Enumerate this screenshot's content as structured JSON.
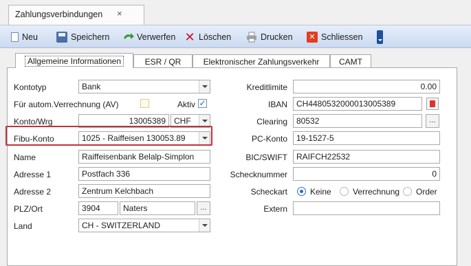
{
  "window": {
    "tab_title": "Zahlungsverbindungen",
    "tab_close": "×"
  },
  "toolbar": {
    "neu": "Neu",
    "speichern": "Speichern",
    "verwerfen": "Verwerfen",
    "loeschen": "Löschen",
    "drucken": "Drucken",
    "schliessen": "Schliessen"
  },
  "tabs": [
    {
      "label": "Allgemeine Informationen"
    },
    {
      "label": "ESR / QR"
    },
    {
      "label": "Elektronischer Zahlungsverkehr"
    },
    {
      "label": "CAMT"
    }
  ],
  "form_left": {
    "kontotyp_label": "Kontotyp",
    "kontotyp_value": "Bank",
    "av_label": "Für autom.Verrechnung (AV)",
    "av_checked": false,
    "aktiv_label": "Aktiv",
    "aktiv_checked": true,
    "konto_label": "Konto/Wrg",
    "konto_value": "13005389",
    "currency_value": "CHF",
    "fibu_label": "Fibu-Konto",
    "fibu_value": "1025 - Raiffeisen 130053.89",
    "name_label": "Name",
    "name_value": "Raiffeisenbank Belalp-Simplon",
    "adresse1_label": "Adresse 1",
    "adresse1_value": "Postfach 336",
    "adresse2_label": "Adresse 2",
    "adresse2_value": "Zentrum Kelchbach",
    "plz_label": "PLZ/Ort",
    "plz_value": "3904",
    "ort_value": "Naters",
    "land_label": "Land",
    "land_value": "CH - SWITZERLAND",
    "dots": "..."
  },
  "form_right": {
    "kreditlimite_label": "Kreditlimite",
    "kreditlimite_value": "0.00",
    "iban_label": "IBAN",
    "iban_value": "CH4480532000013005389",
    "clearing_label": "Clearing",
    "clearing_value": "80532",
    "pc_label": "PC-Konto",
    "pc_value": "19-1527-5",
    "bic_label": "BIC/SWIFT",
    "bic_value": "RAIFCH22532",
    "scheck_label": "Schecknummer",
    "scheck_value": "0",
    "scheckart_label": "Scheckart",
    "scheckart_options": [
      "Keine",
      "Verrechnung",
      "Order"
    ],
    "scheckart_selected": "Keine",
    "extern_label": "Extern",
    "extern_value": "",
    "dots": "..."
  },
  "colors": {
    "highlight": "#c2323b",
    "toolbar_top": "#e6eefa",
    "toolbar_bottom": "#cbdaf0"
  },
  "icons": [
    "new-document-icon",
    "floppy-save-icon",
    "discard-icon",
    "delete-x-icon",
    "printer-icon",
    "close-icon",
    "toolbar-overflow-icon",
    "ellipsis-icon",
    "pdf-icon"
  ]
}
